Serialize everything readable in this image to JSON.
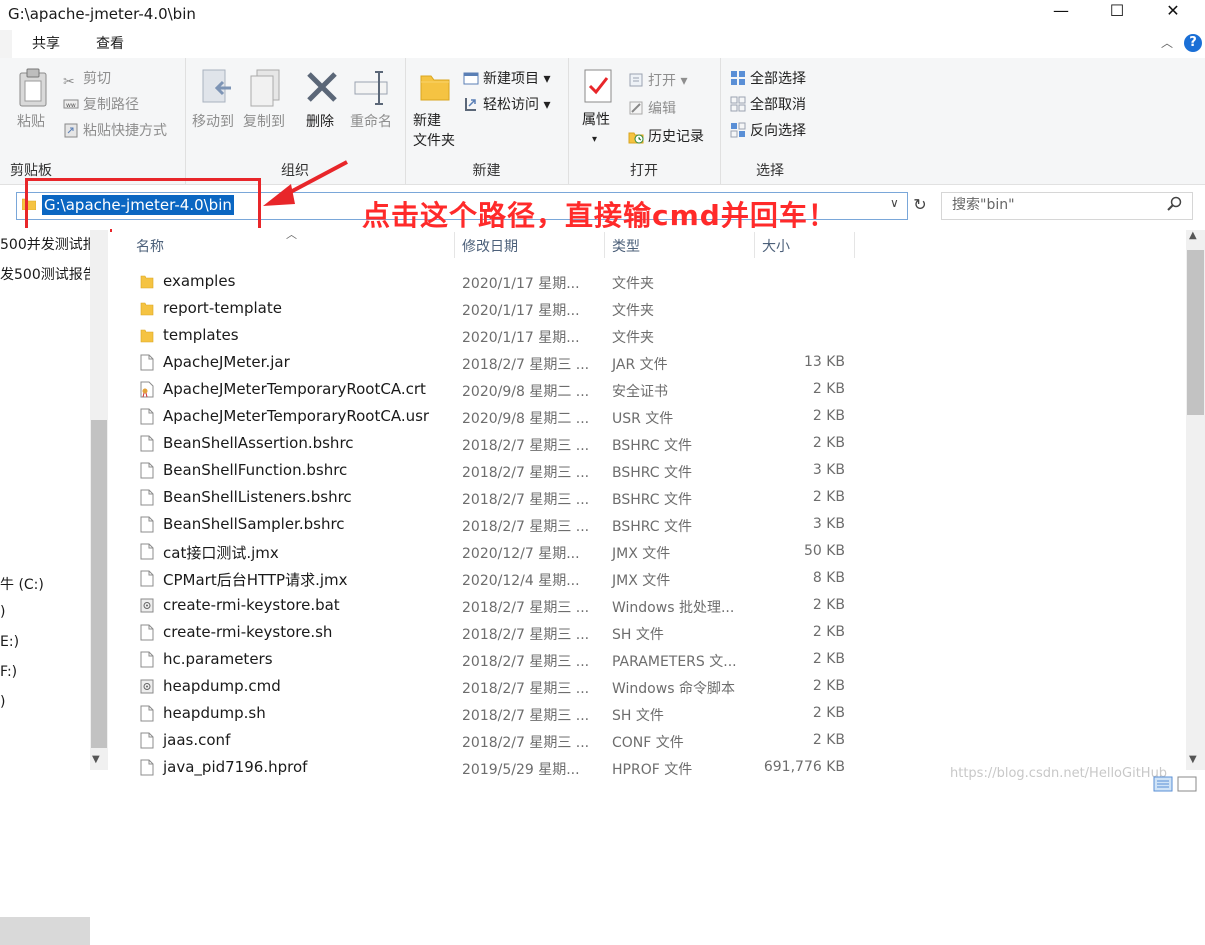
{
  "window": {
    "title": "G:\\apache-jmeter-4.0\\bin",
    "minimize": "—",
    "maximize": "☐",
    "close": "✕"
  },
  "ribbon_tabs": {
    "share": "共享",
    "view": "查看"
  },
  "ribbon": {
    "clipboard": {
      "label": "剪贴板",
      "paste": "粘贴",
      "cut": "剪切",
      "copy_path": "复制路径",
      "paste_shortcut": "粘贴快捷方式"
    },
    "organize": {
      "label": "组织",
      "move_to": "移动到",
      "copy_to": "复制到",
      "delete": "删除",
      "rename": "重命名"
    },
    "new": {
      "label": "新建",
      "new_folder_line1": "新建",
      "new_folder_line2": "文件夹",
      "new_item": "新建项目",
      "easy_access": "轻松访问"
    },
    "open": {
      "label": "打开",
      "properties": "属性",
      "open": "打开",
      "edit": "编辑",
      "history": "历史记录"
    },
    "select": {
      "label": "选择",
      "select_all": "全部选择",
      "select_none": "全部取消",
      "invert": "反向选择"
    }
  },
  "address": {
    "path": "G:\\apache-jmeter-4.0\\bin"
  },
  "search": {
    "placeholder": "搜索\"bin\""
  },
  "annotation": {
    "text": "点击这个路径，直接输cmd并回车！"
  },
  "nav": {
    "items": [
      "500并发测试报",
      "发500测试报告",
      "牛 (C:)",
      ")",
      "E:)",
      "F:)",
      ")"
    ]
  },
  "columns": {
    "name": "名称",
    "date": "修改日期",
    "type": "类型",
    "size": "大小"
  },
  "files": [
    {
      "name": "examples",
      "date": "2020/1/17 星期...",
      "type": "文件夹",
      "size": "",
      "icon": "folder"
    },
    {
      "name": "report-template",
      "date": "2020/1/17 星期...",
      "type": "文件夹",
      "size": "",
      "icon": "folder"
    },
    {
      "name": "templates",
      "date": "2020/1/17 星期...",
      "type": "文件夹",
      "size": "",
      "icon": "folder"
    },
    {
      "name": "ApacheJMeter.jar",
      "date": "2018/2/7 星期三 ...",
      "type": "JAR 文件",
      "size": "13 KB",
      "icon": "file"
    },
    {
      "name": "ApacheJMeterTemporaryRootCA.crt",
      "date": "2020/9/8 星期二 ...",
      "type": "安全证书",
      "size": "2 KB",
      "icon": "cert"
    },
    {
      "name": "ApacheJMeterTemporaryRootCA.usr",
      "date": "2020/9/8 星期二 ...",
      "type": "USR 文件",
      "size": "2 KB",
      "icon": "file"
    },
    {
      "name": "BeanShellAssertion.bshrc",
      "date": "2018/2/7 星期三 ...",
      "type": "BSHRC 文件",
      "size": "2 KB",
      "icon": "file"
    },
    {
      "name": "BeanShellFunction.bshrc",
      "date": "2018/2/7 星期三 ...",
      "type": "BSHRC 文件",
      "size": "3 KB",
      "icon": "file"
    },
    {
      "name": "BeanShellListeners.bshrc",
      "date": "2018/2/7 星期三 ...",
      "type": "BSHRC 文件",
      "size": "2 KB",
      "icon": "file"
    },
    {
      "name": "BeanShellSampler.bshrc",
      "date": "2018/2/7 星期三 ...",
      "type": "BSHRC 文件",
      "size": "3 KB",
      "icon": "file"
    },
    {
      "name": "cat接口测试.jmx",
      "date": "2020/12/7 星期...",
      "type": "JMX 文件",
      "size": "50 KB",
      "icon": "file"
    },
    {
      "name": "CPMart后台HTTP请求.jmx",
      "date": "2020/12/4 星期...",
      "type": "JMX 文件",
      "size": "8 KB",
      "icon": "file"
    },
    {
      "name": "create-rmi-keystore.bat",
      "date": "2018/2/7 星期三 ...",
      "type": "Windows 批处理...",
      "size": "2 KB",
      "icon": "script"
    },
    {
      "name": "create-rmi-keystore.sh",
      "date": "2018/2/7 星期三 ...",
      "type": "SH 文件",
      "size": "2 KB",
      "icon": "file"
    },
    {
      "name": "hc.parameters",
      "date": "2018/2/7 星期三 ...",
      "type": "PARAMETERS 文...",
      "size": "2 KB",
      "icon": "file"
    },
    {
      "name": "heapdump.cmd",
      "date": "2018/2/7 星期三 ...",
      "type": "Windows 命令脚本",
      "size": "2 KB",
      "icon": "script"
    },
    {
      "name": "heapdump.sh",
      "date": "2018/2/7 星期三 ...",
      "type": "SH 文件",
      "size": "2 KB",
      "icon": "file"
    },
    {
      "name": "jaas.conf",
      "date": "2018/2/7 星期三 ...",
      "type": "CONF 文件",
      "size": "2 KB",
      "icon": "file"
    },
    {
      "name": "java_pid7196.hprof",
      "date": "2019/5/29 星期...",
      "type": "HPROF 文件",
      "size": "691,776 KB",
      "icon": "file"
    }
  ],
  "watermark": "https://blog.csdn.net/HelloGitHub",
  "colors": {
    "accent": "#0a66c2",
    "annotation": "#e8262a",
    "folder": "#f5c342"
  }
}
